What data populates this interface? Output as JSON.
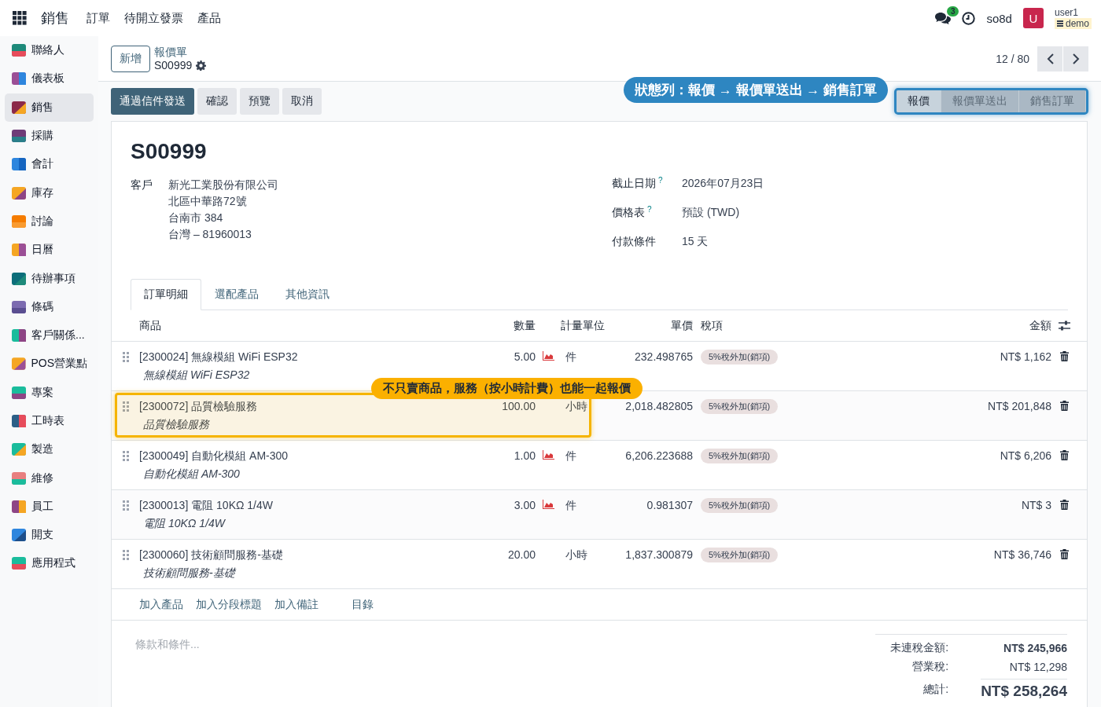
{
  "navbar": {
    "app_title": "銷售",
    "menu": [
      "訂單",
      "待開立發票",
      "產品"
    ],
    "message_count": "3",
    "company": "so8d",
    "avatar_letter": "U",
    "user": "user1",
    "database": "demo"
  },
  "sidebar": {
    "items": [
      {
        "label": "聯絡人",
        "selected": false
      },
      {
        "label": "儀表板",
        "selected": false
      },
      {
        "label": "銷售",
        "selected": true
      },
      {
        "label": "採購",
        "selected": false
      },
      {
        "label": "會計",
        "selected": false
      },
      {
        "label": "庫存",
        "selected": false
      },
      {
        "label": "討論",
        "selected": false
      },
      {
        "label": "日曆",
        "selected": false
      },
      {
        "label": "待辦事項",
        "selected": false
      },
      {
        "label": "條碼",
        "selected": false
      },
      {
        "label": "客戶關係...",
        "selected": false
      },
      {
        "label": "POS營業點",
        "selected": false
      },
      {
        "label": "專案",
        "selected": false
      },
      {
        "label": "工時表",
        "selected": false
      },
      {
        "label": "製造",
        "selected": false
      },
      {
        "label": "維修",
        "selected": false
      },
      {
        "label": "員工",
        "selected": false
      },
      {
        "label": "開支",
        "selected": false
      },
      {
        "label": "應用程式",
        "selected": false
      }
    ]
  },
  "control_panel": {
    "new_button": "新增",
    "breadcrumb": "報價單",
    "record": "S00999",
    "pager": "12 / 80"
  },
  "actions": [
    {
      "label": "通過信件發送",
      "primary": true
    },
    {
      "label": "確認",
      "primary": false
    },
    {
      "label": "預覽",
      "primary": false
    },
    {
      "label": "取消",
      "primary": false
    }
  ],
  "status_bar": {
    "callout": "狀態列：報價 → 報價單送出 → 銷售訂單",
    "steps": [
      {
        "label": "報價",
        "selected": true
      },
      {
        "label": "報價單送出",
        "selected": false
      },
      {
        "label": "銷售訂單",
        "selected": false
      }
    ]
  },
  "form": {
    "title": "S00999",
    "customer": {
      "label": "客戶",
      "name": "新光工業股份有限公司",
      "address": [
        "北區中華路72號",
        "台南市 384",
        "台灣 – 81960013"
      ]
    },
    "fields": [
      {
        "label": "截止日期",
        "help": "?",
        "value": "2026年07月23日"
      },
      {
        "label": "價格表",
        "help": "?",
        "value": "預設 (TWD)"
      },
      {
        "label": "付款條件",
        "value": "15 天"
      }
    ]
  },
  "tabs": [
    {
      "label": "訂單明細",
      "selected": true
    },
    {
      "label": "選配產品",
      "selected": false
    },
    {
      "label": "其他資訊",
      "selected": false
    }
  ],
  "order_lines": {
    "columns": [
      "商品",
      "數量",
      "計量單位",
      "單價",
      "稅項",
      "金額"
    ],
    "rows": [
      {
        "product": "[2300024] 無線模組 WiFi ESP32",
        "description": "無線模組 WiFi ESP32",
        "quantity": "5.00",
        "forecast_icon": true,
        "uom": "件",
        "unit_price": "232.498765",
        "tax": "5%稅外加(銷項)",
        "amount": "NT$ 1,162"
      },
      {
        "product": "[2300072] 品質檢驗服務",
        "description": "品質檢驗服務",
        "quantity": "100.00",
        "forecast_icon": false,
        "uom": "小時",
        "unit_price": "2,018.482805",
        "tax": "5%稅外加(銷項)",
        "amount": "NT$ 201,848",
        "callout": "不只賣商品，服務（按小時計費）也能一起報價"
      },
      {
        "product": "[2300049] 自動化模組 AM-300",
        "description": "自動化模組 AM-300",
        "quantity": "1.00",
        "forecast_icon": true,
        "uom": "件",
        "unit_price": "6,206.223688",
        "tax": "5%稅外加(銷項)",
        "amount": "NT$ 6,206"
      },
      {
        "product": "[2300013] 電阻 10KΩ 1/4W",
        "description": "電阻 10KΩ 1/4W",
        "quantity": "3.00",
        "forecast_icon": true,
        "uom": "件",
        "unit_price": "0.981307",
        "tax": "5%稅外加(銷項)",
        "amount": "NT$ 3"
      },
      {
        "product": "[2300060] 技術顧問服務-基礎",
        "description": "技術顧問服務-基礎",
        "quantity": "20.00",
        "forecast_icon": false,
        "uom": "小時",
        "unit_price": "1,837.300879",
        "tax": "5%稅外加(銷項)",
        "amount": "NT$ 36,746"
      }
    ],
    "add_links": [
      "加入產品",
      "加入分段標題",
      "加入備註",
      "目錄"
    ]
  },
  "terms": {
    "placeholder": "條款和條件..."
  },
  "totals": [
    {
      "label": "未連稅金額:",
      "value": "NT$ 245,966",
      "kind": "bold"
    },
    {
      "label": "營業稅:",
      "value": "NT$ 12,298",
      "kind": "normal"
    },
    {
      "label": "總計:",
      "value": "NT$ 258,264",
      "kind": "grand"
    }
  ]
}
